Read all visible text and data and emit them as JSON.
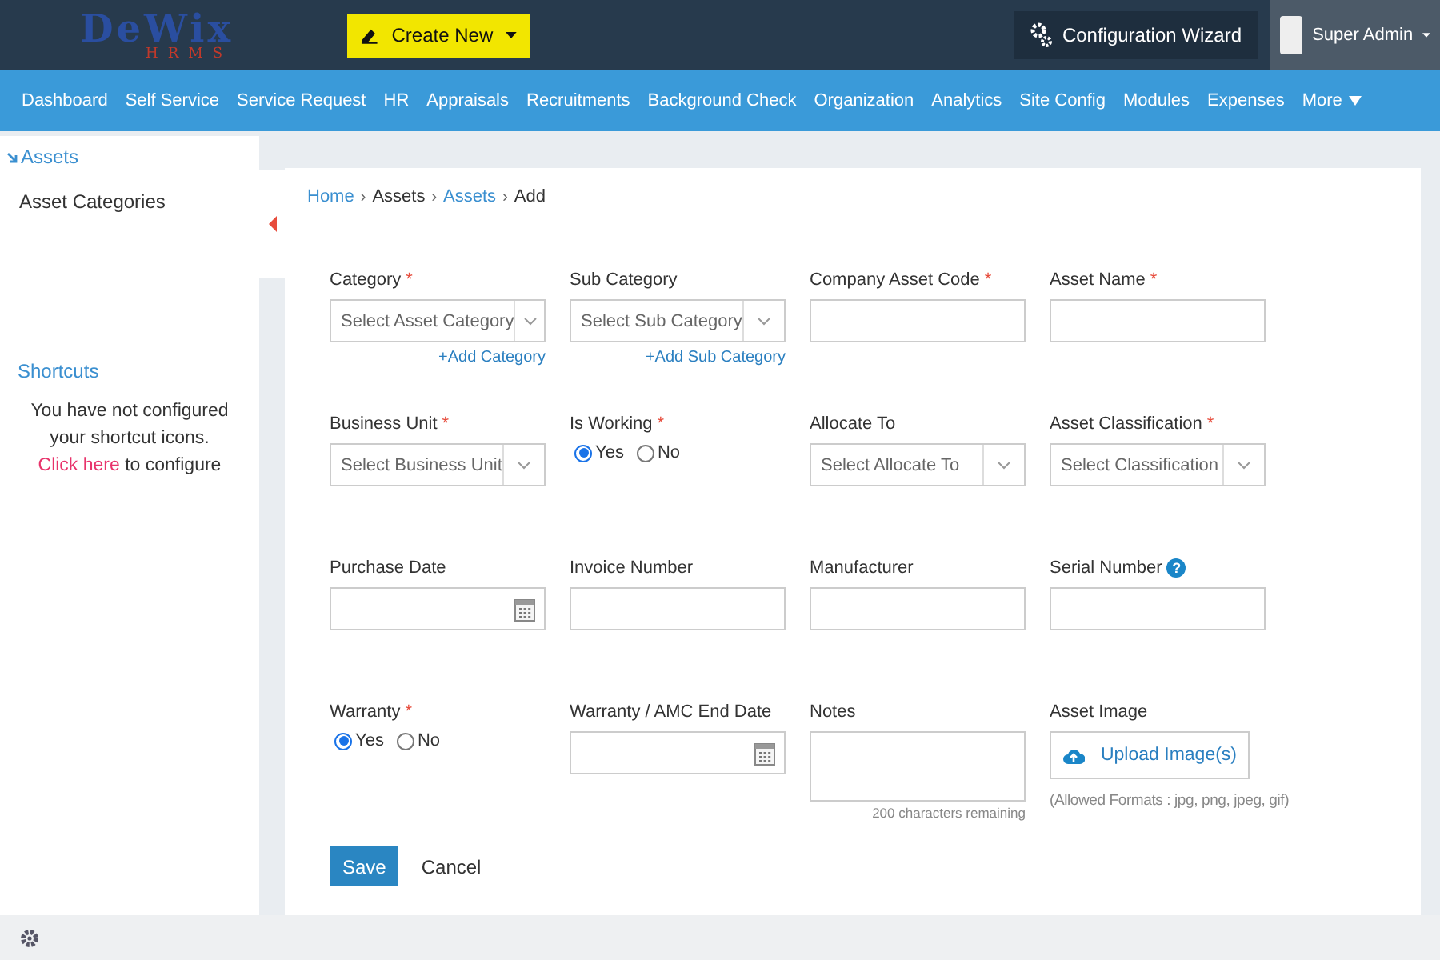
{
  "logo": {
    "name": "DeWix",
    "sub": "HRMS"
  },
  "create_button": {
    "label": "Create New"
  },
  "config_button": {
    "label": "Configuration Wizard"
  },
  "user": {
    "name": "Super Admin"
  },
  "nav": [
    {
      "label": "Dashboard"
    },
    {
      "label": "Self Service"
    },
    {
      "label": "Service Request"
    },
    {
      "label": "HR"
    },
    {
      "label": "Appraisals"
    },
    {
      "label": "Recruitments"
    },
    {
      "label": "Background Check"
    },
    {
      "label": "Organization"
    },
    {
      "label": "Analytics"
    },
    {
      "label": "Site Config"
    },
    {
      "label": "Modules"
    },
    {
      "label": "Expenses"
    },
    {
      "label": "More",
      "dropdown": true
    }
  ],
  "sidebar": {
    "section": "Assets",
    "items": [
      {
        "label": "Asset Categories"
      }
    ],
    "shortcuts_title": "Shortcuts",
    "shortcuts_text_before": "You have not configured your shortcut icons.",
    "shortcuts_link": "Click here",
    "shortcuts_text_after": "to configure"
  },
  "breadcrumb": [
    {
      "label": "Home",
      "link": true
    },
    {
      "separator": "›",
      "label": "Assets",
      "link": false
    },
    {
      "separator": "›",
      "label": "Assets",
      "link": true
    },
    {
      "separator": "›",
      "label": "Add",
      "link": false
    }
  ],
  "fields": [
    {
      "kind": "select",
      "label": "Category",
      "marker": "*",
      "placeholder": "Select Asset Category",
      "link": "+Add Category"
    },
    {
      "kind": "select",
      "label": "Sub Category",
      "placeholder": "Select Sub Category",
      "link": "+Add Sub Category"
    },
    {
      "kind": "text",
      "label": "Company Asset Code",
      "marker": "*"
    },
    {
      "kind": "text",
      "label": "Asset Name",
      "marker": "*"
    },
    {
      "kind": "select",
      "label": "Business Unit",
      "marker": "*",
      "placeholder": "Select Business Unit"
    },
    {
      "kind": "radio",
      "label": "Is Working",
      "marker": "*",
      "options": [
        {
          "label": "Yes",
          "selected": true
        },
        {
          "label": "No",
          "selected": false
        }
      ]
    },
    {
      "kind": "select",
      "label": "Allocate To",
      "placeholder": "Select Allocate To"
    },
    {
      "kind": "select",
      "label": "Asset Classification",
      "marker": "*",
      "placeholder": "Select Classification"
    },
    {
      "kind": "date",
      "label": "Purchase Date"
    },
    {
      "kind": "text",
      "label": "Invoice Number"
    },
    {
      "kind": "text",
      "label": "Manufacturer"
    },
    {
      "kind": "text",
      "label": "Serial Number",
      "help": "?"
    },
    {
      "kind": "radio",
      "label": "Warranty",
      "marker": "*",
      "options": [
        {
          "label": "Yes",
          "selected": true
        },
        {
          "label": "No",
          "selected": false
        }
      ]
    },
    {
      "kind": "date",
      "label": "Warranty / AMC End Date"
    },
    {
      "kind": "textarea",
      "label": "Notes",
      "hint": "200 characters remaining"
    },
    {
      "kind": "upload",
      "label": "Asset Image",
      "button": "Upload Image(s)",
      "hint": "(Allowed Formats : jpg, png, jpeg, gif)"
    }
  ],
  "actions": {
    "save": "Save",
    "cancel": "Cancel"
  }
}
